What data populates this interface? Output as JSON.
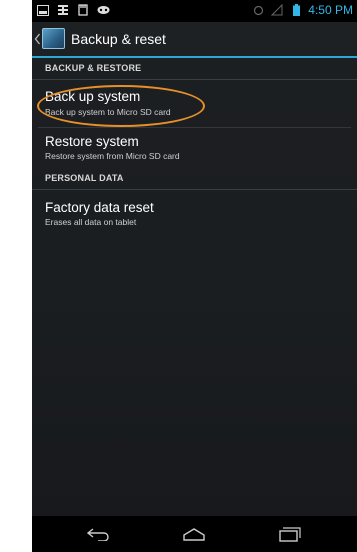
{
  "status_bar": {
    "time": "4:50 PM",
    "left_icons": [
      "image-notification-icon",
      "keyboard-notification-icon",
      "sd-card-notification-icon",
      "game-controller-notification-icon"
    ],
    "right_icons": [
      "sync-icon",
      "signal-icon",
      "battery-icon"
    ],
    "time_color": "#33b5e5"
  },
  "action_bar": {
    "title": "Backup & reset",
    "accent": "#2fa6d3"
  },
  "sections": {
    "backup_restore": {
      "label": "BACKUP & RESTORE"
    },
    "personal_data": {
      "label": "PERSONAL DATA"
    }
  },
  "items": {
    "back_up": {
      "title": "Back up system",
      "subtitle": "Back up system to Micro SD card"
    },
    "restore": {
      "title": "Restore system",
      "subtitle": "Restore system from Micro SD card"
    },
    "factory_reset": {
      "title": "Factory data reset",
      "subtitle": "Erases all data on tablet"
    }
  },
  "annotation": {
    "color": "#e7902a"
  },
  "nav_bar": {
    "buttons": [
      "back-icon",
      "home-icon",
      "recent-apps-icon"
    ]
  }
}
